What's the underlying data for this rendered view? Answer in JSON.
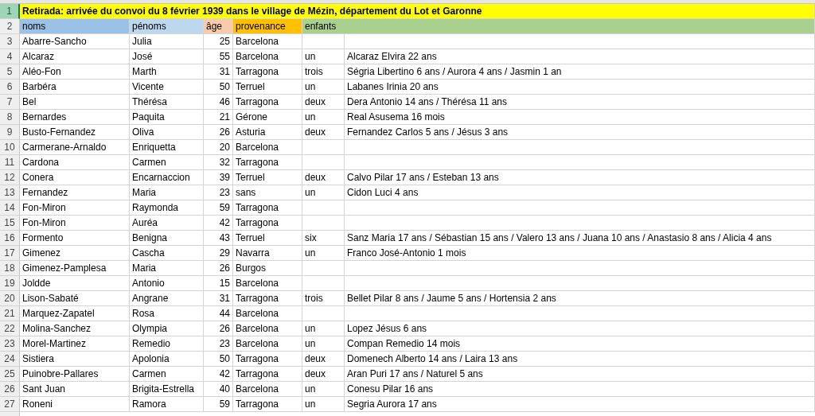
{
  "title_row": {
    "number": "1",
    "selected": true,
    "text": "Retirada: arrivée du convoi du 8 février 1939 dans le village de Mézin, département du Lot et Garonne"
  },
  "header_row": {
    "number": "2",
    "selected": false,
    "columns": [
      {
        "label": "noms",
        "color": "#9bc2e6"
      },
      {
        "label": "pénoms",
        "color": "#bdd7ee"
      },
      {
        "label": "âge",
        "color": "#f8cbad"
      },
      {
        "label": "provenance",
        "color": "#ffc000"
      },
      {
        "label": "enfants",
        "color": "#a9d08e"
      }
    ]
  },
  "rows": [
    {
      "number": "3",
      "selected": false,
      "name": "Abarre-Sancho",
      "first_name": "Julia",
      "age": "25",
      "origin": "Barcelona"
    },
    {
      "number": "4",
      "selected": false,
      "name": "Alcaraz",
      "first_name": "José",
      "age": "55",
      "origin": "Barcelona",
      "children_count": "un",
      "children": "Alcaraz Elvira 22 ans"
    },
    {
      "number": "5",
      "selected": false,
      "name": "Aléo-Fon",
      "first_name": "Marth",
      "age": "31",
      "origin": "Tarragona",
      "children_count": "trois",
      "children": "Ségria Libertino 6 ans / Aurora 4 ans / Jasmin 1 an"
    },
    {
      "number": "6",
      "selected": false,
      "name": "Barbéra",
      "first_name": "Vicente",
      "age": "50",
      "origin": "Terruel",
      "children_count": "un",
      "children": "Labanes Irinia 20 ans"
    },
    {
      "number": "7",
      "selected": false,
      "name": "Bel",
      "first_name": "Thérésa",
      "age": "46",
      "origin": "Tarragona",
      "children_count": "deux",
      "children": "Dera Antonio 14 ans / Thérésa 11 ans"
    },
    {
      "number": "8",
      "selected": false,
      "name": "Bernardes",
      "first_name": "Paquita",
      "age": "21",
      "origin": "Gérone",
      "children_count": "un",
      "children": "Real Asusema 16 mois"
    },
    {
      "number": "9",
      "selected": false,
      "name": "Busto-Fernandez",
      "first_name": "Oliva",
      "age": "26",
      "origin": "Asturia",
      "children_count": "deux",
      "children": "Fernandez Carlos  5 ans / Jésus 3 ans"
    },
    {
      "number": "10",
      "selected": false,
      "name": "Carmerane-Arnaldo",
      "first_name": "Enriquetta",
      "age": "20",
      "origin": "Barcelona"
    },
    {
      "number": "11",
      "selected": false,
      "name": "Cardona",
      "first_name": "Carmen",
      "age": "32",
      "origin": "Tarragona"
    },
    {
      "number": "12",
      "selected": false,
      "name": "Conera",
      "first_name": "Encarnaccion",
      "age": "39",
      "origin": "Terruel",
      "children_count": "deux",
      "children": "Calvo Pilar 17 ans / Esteban 13 ans"
    },
    {
      "number": "13",
      "selected": false,
      "name": "Fernandez",
      "first_name": "Maria",
      "age": "23",
      "origin": "sans",
      "children_count": "un",
      "children": "Cidon Luci 4 ans"
    },
    {
      "number": "14",
      "selected": false,
      "name": "Fon-Miron",
      "first_name": "Raymonda",
      "age": "59",
      "origin": "Tarragona"
    },
    {
      "number": "15",
      "selected": false,
      "name": "Fon-Miron",
      "first_name": "Auréa",
      "age": "42",
      "origin": "Tarragona"
    },
    {
      "number": "16",
      "selected": false,
      "name": "Formento",
      "first_name": "Benigna",
      "age": "43",
      "origin": "Terruel",
      "children_count": "six",
      "children": "Sanz Maria 17 ans / Sébastian 15 ans / Valero 13 ans / Juana 10 ans / Anastasio 8 ans / Alicia 4 ans"
    },
    {
      "number": "17",
      "selected": false,
      "name": "Gimenez",
      "first_name": "Cascha",
      "age": "29",
      "origin": "Navarra",
      "children_count": "un",
      "children": "Franco José-Antonio 1 mois"
    },
    {
      "number": "18",
      "selected": false,
      "name": "Gimenez-Pamplesa",
      "first_name": "Maria",
      "age": "26",
      "origin": "Burgos"
    },
    {
      "number": "19",
      "selected": false,
      "name": "Joldde",
      "first_name": "Antonio",
      "age": "15",
      "origin": "Barcelona"
    },
    {
      "number": "20",
      "selected": false,
      "name": "Lison-Sabaté",
      "first_name": "Angrane",
      "age": "31",
      "origin": "Tarragona",
      "children_count": "trois",
      "children": "Bellet Pilar 8 ans / Jaume 5 ans / Hortensia 2 ans"
    },
    {
      "number": "21",
      "selected": false,
      "name": "Marquez-Zapatel",
      "first_name": "Rosa",
      "age": "44",
      "origin": "Barcelona"
    },
    {
      "number": "22",
      "selected": false,
      "name": "Molina-Sanchez",
      "first_name": "Olympia",
      "age": "26",
      "origin": "Barcelona",
      "children_count": "un",
      "children": "Lopez Jésus 6 ans"
    },
    {
      "number": "23",
      "selected": false,
      "name": "Morel-Martinez",
      "first_name": "Remedio",
      "age": "23",
      "origin": "Barcelona",
      "children_count": "un",
      "children": "Compan Remedio 14 mois"
    },
    {
      "number": "24",
      "selected": false,
      "name": "Sistiera",
      "first_name": "Apolonia",
      "age": "50",
      "origin": "Tarragona",
      "children_count": "deux",
      "children": "Domenech Alberto 14 ans / Laira 13 ans"
    },
    {
      "number": "25",
      "selected": false,
      "name": "Puinobre-Pallares",
      "first_name": "Carmen",
      "age": "42",
      "origin": "Tarragona",
      "children_count": "deux",
      "children": "Aran Puri 17 ans / Naturel 5 ans"
    },
    {
      "number": "26",
      "selected": false,
      "name": "Sant Juan",
      "first_name": "Brigita-Estrella",
      "age": "40",
      "origin": "Barcelona",
      "children_count": "un",
      "children": "Conesu Pilar 16 ans"
    },
    {
      "number": "27",
      "selected": false,
      "name": "Roneni",
      "first_name": "Ramora",
      "age": "59",
      "origin": "Tarragona",
      "children_count": "un",
      "children": "Segria Aurora 17 ans"
    }
  ]
}
